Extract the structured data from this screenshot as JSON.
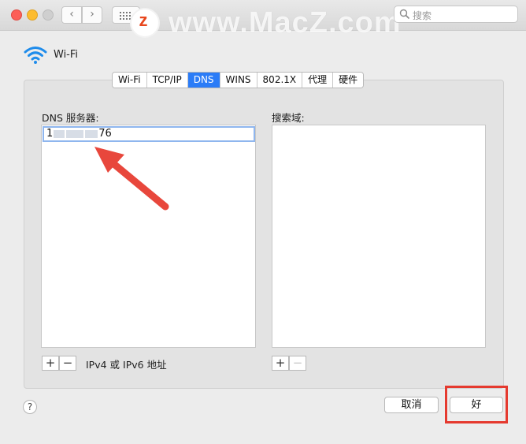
{
  "titlebar": {
    "search_placeholder": "搜索",
    "watermark": "www.MacZ.com",
    "logo_letter": "z"
  },
  "pane": {
    "title": "Wi-Fi"
  },
  "tabs": [
    {
      "label": "Wi-Fi"
    },
    {
      "label": "TCP/IP"
    },
    {
      "label": "DNS"
    },
    {
      "label": "WINS"
    },
    {
      "label": "802.1X"
    },
    {
      "label": "代理"
    },
    {
      "label": "硬件"
    }
  ],
  "dns": {
    "servers_label": "DNS 服务器:",
    "entry_prefix": "1",
    "entry_suffix": "76",
    "hint": "IPv4 或 IPv6 地址"
  },
  "search_domains": {
    "label": "搜索域:"
  },
  "buttons": {
    "help": "?",
    "add": "+",
    "remove": "−",
    "cancel": "取消",
    "ok": "好"
  },
  "colors": {
    "accent": "#2b7cf7",
    "highlight": "#e53a2f"
  }
}
